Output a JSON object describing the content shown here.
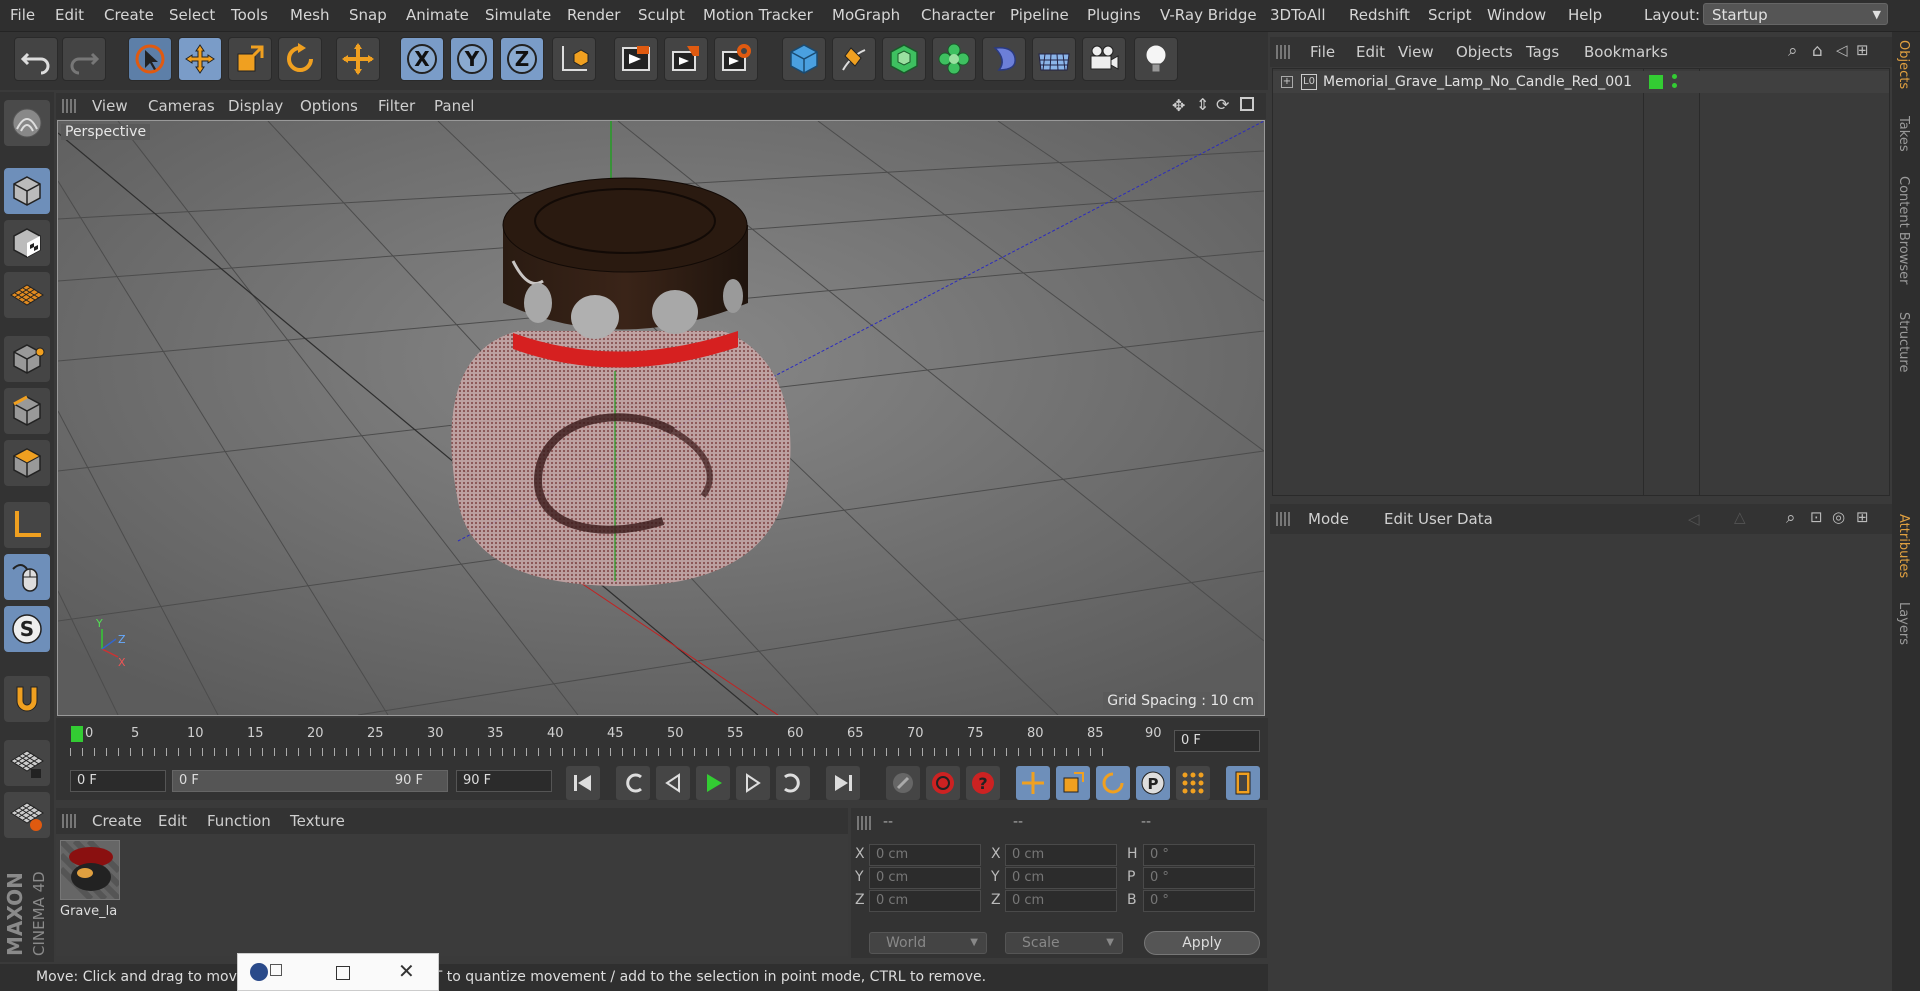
{
  "menu": {
    "items": [
      "File",
      "Edit",
      "Create",
      "Select",
      "Tools",
      "Mesh",
      "Snap",
      "Animate",
      "Simulate",
      "Render",
      "Sculpt",
      "Motion Tracker",
      "MoGraph",
      "Character",
      "Pipeline",
      "Plugins",
      "V-Ray Bridge",
      "3DToAll",
      "Redshift",
      "Script",
      "Window",
      "Help"
    ],
    "layout_label": "Layout:",
    "layout_value": "Startup"
  },
  "toolbar": {
    "icons": [
      "undo-icon",
      "redo-icon",
      "select-arrow-icon",
      "move-icon",
      "scale-icon",
      "rotate-icon",
      "move-alt-icon",
      "x-axis-icon",
      "y-axis-icon",
      "z-axis-icon",
      "coordinate-system-icon",
      "render-view-icon",
      "render-picture-viewer-icon",
      "render-settings-icon",
      "cube-icon",
      "pen-icon",
      "subdivision-icon",
      "cloner-icon",
      "deformer-icon",
      "floor-icon",
      "camera-icon",
      "light-icon"
    ],
    "x_label": "X",
    "y_label": "Y",
    "z_label": "Z"
  },
  "viewport": {
    "menu": [
      "View",
      "Cameras",
      "Display",
      "Options",
      "Filter",
      "Panel"
    ],
    "label": "Perspective",
    "grid_spacing": "Grid Spacing : 10 cm",
    "axis_x": "X",
    "axis_y": "Y",
    "axis_z": "Z"
  },
  "left_toolbar": {
    "icons": [
      "make-editable-icon",
      "model-mode-icon",
      "texture-mode-icon",
      "workplane-icon",
      "points-mode-icon",
      "edges-mode-icon",
      "polygons-mode-icon",
      "axis-mode-icon",
      "tweak-mode-icon",
      "solo-icon",
      "magnet-icon",
      "snap-grid-icon",
      "lock-workplane-icon"
    ]
  },
  "timeline": {
    "ticks": [
      "0",
      "5",
      "10",
      "15",
      "20",
      "25",
      "30",
      "35",
      "40",
      "45",
      "50",
      "55",
      "60",
      "65",
      "70",
      "75",
      "80",
      "85",
      "90"
    ],
    "current_frame": "0 F"
  },
  "playback": {
    "start_field": "0 F",
    "range_start": "0 F",
    "range_end": "90 F",
    "end_field": "90 F"
  },
  "material_panel": {
    "menu": [
      "Create",
      "Edit",
      "Function",
      "Texture"
    ],
    "material_name": "Grave_la"
  },
  "coordinates": {
    "headers": [
      "--",
      "--",
      "--"
    ],
    "col1_labels": [
      "X",
      "Y",
      "Z"
    ],
    "col1_values": [
      "0 cm",
      "0 cm",
      "0 cm"
    ],
    "col2_labels": [
      "X",
      "Y",
      "Z"
    ],
    "col2_values": [
      "0 cm",
      "0 cm",
      "0 cm"
    ],
    "col3_labels": [
      "H",
      "P",
      "B"
    ],
    "col3_values": [
      "0 °",
      "0 °",
      "0 °"
    ],
    "mode_select": "World",
    "size_select": "Scale",
    "apply_label": "Apply"
  },
  "status": {
    "text": "Move: Click and drag to move elements. Hold down SHIFT to quantize movement / add to the selection in point mode, CTRL to remove."
  },
  "objects_manager": {
    "menu": [
      "File",
      "Edit",
      "View",
      "Objects",
      "Tags",
      "Bookmarks"
    ],
    "object_name": "Memorial_Grave_Lamp_No_Candle_Red_001"
  },
  "attributes_manager": {
    "menu": [
      "Mode",
      "Edit",
      "User Data"
    ]
  },
  "right_tabs": [
    "Objects",
    "Takes",
    "Content Browser",
    "Structure",
    "Attributes",
    "Layers"
  ],
  "logo": {
    "brand": "MAXON",
    "product": "CINEMA 4D"
  },
  "colors": {
    "accent_blue": "#6e8fba",
    "active_tab": "#e0a040",
    "status_green": "#33cc33",
    "red_band": "#d62020"
  }
}
